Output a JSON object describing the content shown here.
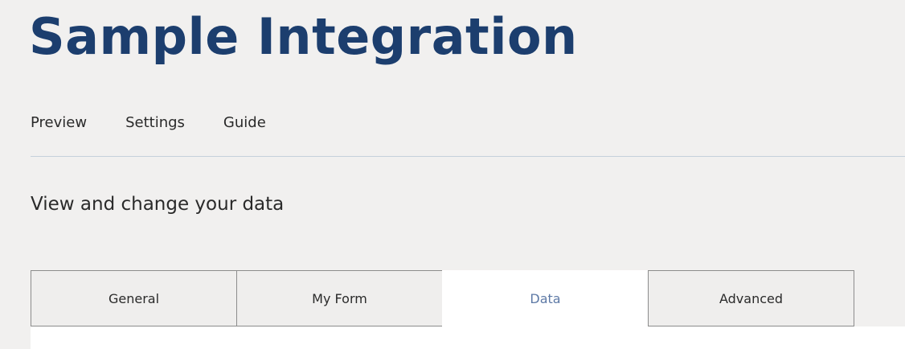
{
  "header": {
    "title": "Sample Integration"
  },
  "nav": {
    "items": [
      {
        "label": "Preview"
      },
      {
        "label": "Settings"
      },
      {
        "label": "Guide"
      }
    ]
  },
  "main": {
    "subtitle": "View and change your data",
    "tabs": [
      {
        "label": "General",
        "active": false
      },
      {
        "label": "My Form",
        "active": false
      },
      {
        "label": "Data",
        "active": true
      },
      {
        "label": "Advanced",
        "active": false
      }
    ]
  },
  "colors": {
    "background": "#f1f0ef",
    "title": "#1c3e6e",
    "active_tab_text": "#5e7aa6",
    "divider": "#c5d0db"
  }
}
